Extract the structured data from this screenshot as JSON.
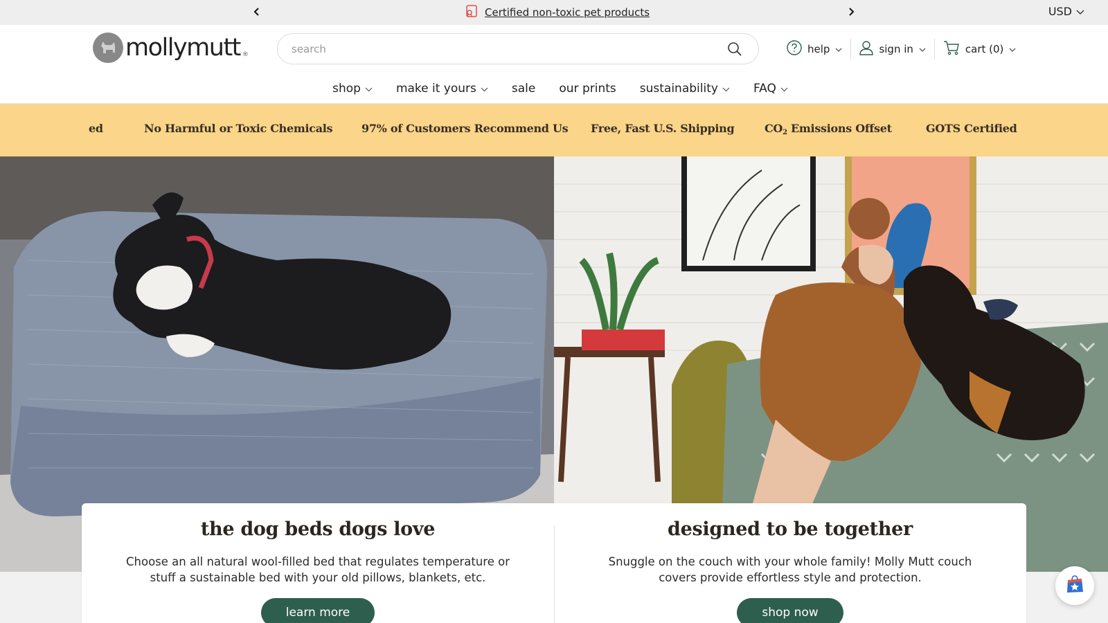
{
  "announcement": {
    "message": "Certified non-toxic pet products",
    "currency": "USD",
    "prev_icon": "chevron-left-icon",
    "next_icon": "chevron-right-icon"
  },
  "header": {
    "logo_text": "mollymutt",
    "logo_reg": "®",
    "search_placeholder": "search",
    "help_label": "help",
    "signin_label": "sign in",
    "cart_label": "cart (0)"
  },
  "nav": {
    "items": [
      {
        "label": "shop",
        "dropdown": true
      },
      {
        "label": "make it yours",
        "dropdown": true
      },
      {
        "label": "sale",
        "dropdown": false
      },
      {
        "label": "our prints",
        "dropdown": false
      },
      {
        "label": "sustainability",
        "dropdown": true
      },
      {
        "label": "FAQ",
        "dropdown": true
      }
    ]
  },
  "value_props": {
    "partial": "ed",
    "items": [
      "No Harmful or Toxic Chemicals",
      "97% of Customers Recommend Us",
      "Free, Fast U.S. Shipping",
      "GOTS Certified"
    ],
    "co2_prefix": "CO",
    "co2_sub": "2",
    "co2_suffix": " Emissions Offset"
  },
  "cards": [
    {
      "title": "the dog beds dogs love",
      "body": "Choose an all natural wool-filled bed that regulates temperature or stuff a sustainable bed with your old pillows, blankets, etc.",
      "cta": "learn more"
    },
    {
      "title": "designed to be together",
      "body": "Snuggle on the couch with your whole family! Molly Mutt couch covers provide effortless style and protection.",
      "cta": "shop now"
    }
  ],
  "colors": {
    "band": "#fad58a",
    "cta": "#2e5e4e",
    "announce_bg": "#eeeeee"
  }
}
